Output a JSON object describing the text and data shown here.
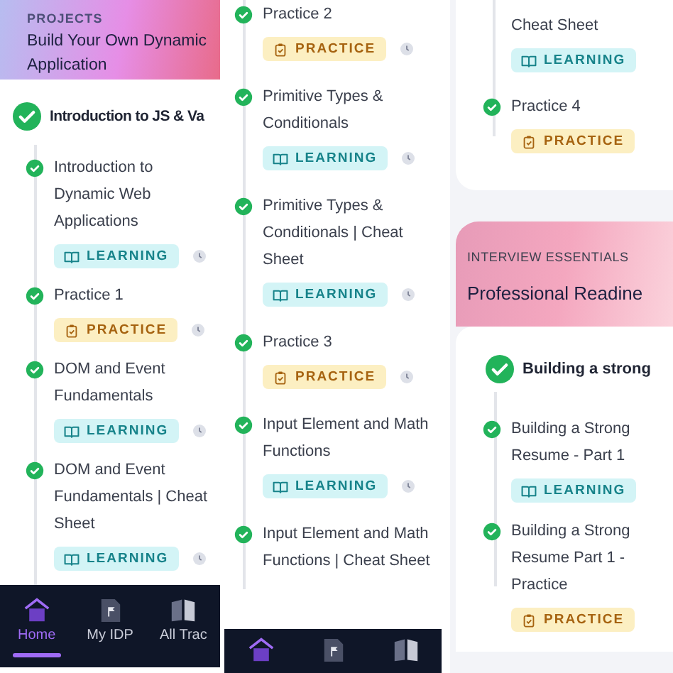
{
  "panels": [
    {
      "clock_icons": true,
      "blocks": [
        {
          "kind": "header",
          "label": "PROJECTS",
          "title": "Build Your Own Dynamic",
          "title_2": "Application"
        },
        {
          "kind": "module",
          "title": "Introduction to JS & Va",
          "completed": true
        },
        {
          "kind": "item",
          "title": "Introduction to Dynamic Web Applications",
          "tag": {
            "label": "LEARNING",
            "kind": "learning"
          },
          "completed": true
        },
        {
          "kind": "item",
          "title": "Practice 1",
          "tag": {
            "label": "PRACTICE",
            "kind": "practice"
          },
          "completed": true
        },
        {
          "kind": "item",
          "title": "DOM and Event Fundamentals",
          "tag": {
            "label": "LEARNING",
            "kind": "learning"
          },
          "completed": true
        },
        {
          "kind": "item",
          "title": "DOM and Event Fundamentals | Cheat Sheet",
          "tag": {
            "label": "LEARNING",
            "kind": "learning"
          },
          "completed": true
        },
        {
          "kind": "nav",
          "items": [
            {
              "label": "Home",
              "selected": true
            },
            {
              "label": "My IDP",
              "selected": false
            },
            {
              "label": "All Trac",
              "selected": false
            }
          ]
        }
      ]
    },
    {
      "clock_icons": true,
      "blocks": [
        {
          "kind": "item",
          "title": "Practice 2",
          "tag": {
            "label": "PRACTICE",
            "kind": "practice"
          },
          "completed": true
        },
        {
          "kind": "item",
          "title": "Primitive Types & Conditionals",
          "tag": {
            "label": "LEARNING",
            "kind": "learning"
          },
          "completed": true
        },
        {
          "kind": "item",
          "title": "Primitive Types & Conditionals | Cheat Sheet",
          "tag": {
            "label": "LEARNING",
            "kind": "learning"
          },
          "completed": true
        },
        {
          "kind": "item",
          "title": "Practice 3",
          "tag": {
            "label": "PRACTICE",
            "kind": "practice"
          },
          "completed": true
        },
        {
          "kind": "item",
          "title": "Input Element and Math Functions",
          "tag": {
            "label": "LEARNING",
            "kind": "learning"
          },
          "completed": true
        },
        {
          "kind": "item",
          "title": "Input Element and Math Functions | Cheat Sheet",
          "completed": true
        },
        {
          "kind": "nav",
          "items": [
            {
              "selected": true
            },
            {
              "selected": false
            },
            {
              "selected": false
            }
          ]
        }
      ]
    },
    {
      "clock_icons": false,
      "blocks": [
        {
          "kind": "item",
          "title": "Cheat Sheet",
          "tag": {
            "label": "LEARNING",
            "kind": "learning"
          }
        },
        {
          "kind": "item",
          "title": "Practice 4",
          "tag": {
            "label": "PRACTICE",
            "kind": "practice"
          },
          "completed": true
        },
        {
          "kind": "header",
          "label": "INTERVIEW ESSENTIALS",
          "title": "Professional Readine"
        },
        {
          "kind": "module",
          "title": "Building a strong",
          "completed": true
        },
        {
          "kind": "item",
          "title": "Building a Strong Resume - Part 1",
          "tag": {
            "label": "LEARNING",
            "kind": "learning"
          },
          "completed": true
        },
        {
          "kind": "item",
          "title": "Building a Strong Resume Part 1 - Practice",
          "tag": {
            "label": "PRACTICE",
            "kind": "practice"
          },
          "completed": true
        }
      ]
    }
  ]
}
